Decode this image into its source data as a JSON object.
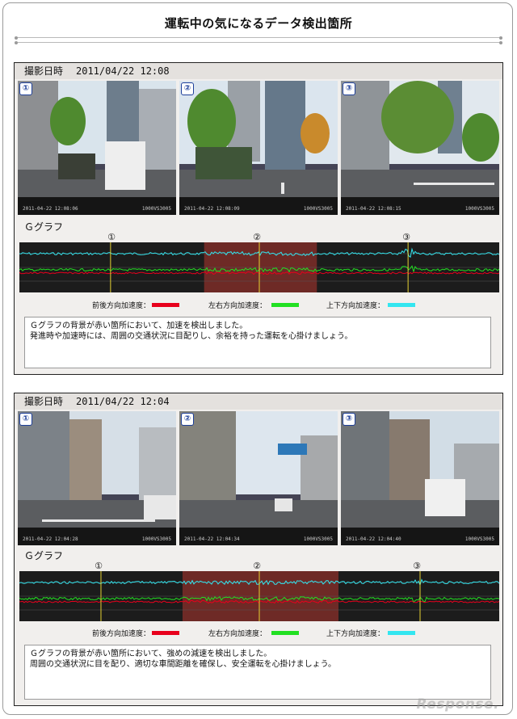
{
  "page": {
    "title": "運転中の気になるデータ検出箇所"
  },
  "legend": {
    "longitudinal": "前後方向加速度：",
    "lateral": "左右方向加速度：",
    "vertical": "上下方向加速度：",
    "colors": {
      "longitudinal": "#e8001c",
      "lateral": "#22e022",
      "vertical": "#33e6f0"
    }
  },
  "reports": [
    {
      "header_label": "撮影日時",
      "timestamp": "2011/04/22 12:08",
      "photos": [
        {
          "badge": "①",
          "stamp": "2011-04-22 12:08:06",
          "id": "1000VS3005"
        },
        {
          "badge": "②",
          "stamp": "2011-04-22 12:08:09",
          "id": "1000VS3005"
        },
        {
          "badge": "③",
          "stamp": "2011-04-22 12:08:15",
          "id": "1000VS3005"
        }
      ],
      "graph_title": "Ｇグラフ",
      "markers": [
        "①",
        "②",
        "③"
      ],
      "highlight_fraction": [
        0.385,
        0.62
      ],
      "marker_positions": [
        0.19,
        0.5,
        0.81
      ],
      "notes": [
        "Ｇグラフの背景が赤い箇所において、加速を検出しました。",
        "発進時や加速時には、周囲の交通状況に目配りし、余裕を持った運転を心掛けましょう。"
      ]
    },
    {
      "header_label": "撮影日時",
      "timestamp": "2011/04/22 12:04",
      "photos": [
        {
          "badge": "①",
          "stamp": "2011-04-22 12:04:28",
          "id": "1000VS3005"
        },
        {
          "badge": "②",
          "stamp": "2011-04-22 12:04:34",
          "id": "1000VS3005"
        },
        {
          "badge": "③",
          "stamp": "2011-04-22 12:04:40",
          "id": "1000VS3005"
        }
      ],
      "graph_title": "Ｇグラフ",
      "markers": [
        "①",
        "②",
        "③"
      ],
      "highlight_fraction": [
        0.34,
        0.665
      ],
      "marker_positions": [
        0.17,
        0.5,
        0.835
      ],
      "notes": [
        "Ｇグラフの背景が赤い箇所において、強めの減速を検出しました。",
        "周囲の交通状況に目を配り、適切な車間距離を確保し、安全運転を心掛けましょう。"
      ]
    }
  ],
  "watermark": "Response."
}
